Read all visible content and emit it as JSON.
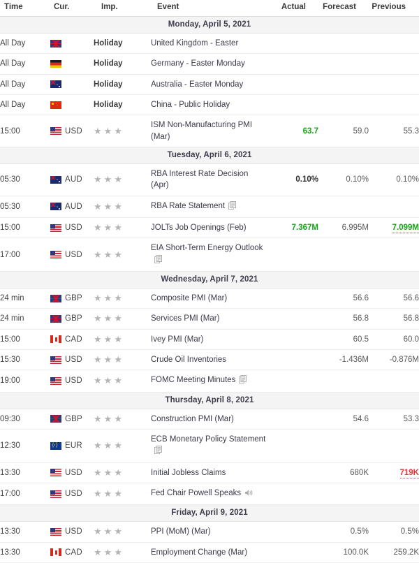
{
  "header": {
    "columns": [
      {
        "key": "time",
        "label": "Time"
      },
      {
        "key": "cur",
        "label": "Cur."
      },
      {
        "key": "imp",
        "label": "Imp."
      },
      {
        "key": "event",
        "label": "Event"
      },
      {
        "key": "actual",
        "label": "Actual"
      },
      {
        "key": "forecast",
        "label": "Forecast"
      },
      {
        "key": "previous",
        "label": "Previous"
      }
    ]
  },
  "colors": {
    "positive": "#13a713",
    "negative": "#e8333b",
    "date_band": "#f4f4f4",
    "star": "#b4b4b4",
    "text": "#3a3a4a"
  },
  "days": [
    {
      "date_label": "Monday, April 5, 2021",
      "rows": [
        {
          "time": "All Day",
          "currency": "",
          "flag": "gb-flag",
          "importance_type": "holiday",
          "importance_label": "Holiday",
          "stars": 0,
          "event": "United Kingdom - Easter",
          "event_icon": "",
          "actual": "",
          "actual_state": "none",
          "forecast": "",
          "previous": "",
          "previous_state": "none"
        },
        {
          "time": "All Day",
          "currency": "",
          "flag": "de-flag",
          "importance_type": "holiday",
          "importance_label": "Holiday",
          "stars": 0,
          "event": "Germany - Easter Monday",
          "event_icon": "",
          "actual": "",
          "actual_state": "none",
          "forecast": "",
          "previous": "",
          "previous_state": "none"
        },
        {
          "time": "All Day",
          "currency": "",
          "flag": "au-flag",
          "importance_type": "holiday",
          "importance_label": "Holiday",
          "stars": 0,
          "event": "Australia - Easter Monday",
          "event_icon": "",
          "actual": "",
          "actual_state": "none",
          "forecast": "",
          "previous": "",
          "previous_state": "none"
        },
        {
          "time": "All Day",
          "currency": "",
          "flag": "cn-flag",
          "importance_type": "holiday",
          "importance_label": "Holiday",
          "stars": 0,
          "event": "China - Public Holiday",
          "event_icon": "",
          "actual": "",
          "actual_state": "none",
          "forecast": "",
          "previous": "",
          "previous_state": "none"
        },
        {
          "time": "15:00",
          "currency": "USD",
          "flag": "us-flag",
          "importance_type": "stars",
          "importance_label": "",
          "stars": 3,
          "event": "ISM Non-Manufacturing PMI (Mar)",
          "event_icon": "",
          "actual": "63.7",
          "actual_state": "up",
          "forecast": "59.0",
          "previous": "55.3",
          "previous_state": "none"
        }
      ]
    },
    {
      "date_label": "Tuesday, April 6, 2021",
      "rows": [
        {
          "time": "05:30",
          "currency": "AUD",
          "flag": "au-flag",
          "importance_type": "stars",
          "importance_label": "",
          "stars": 3,
          "event": "RBA Interest Rate Decision (Apr)",
          "event_icon": "",
          "actual": "0.10%",
          "actual_state": "bold",
          "forecast": "0.10%",
          "previous": "0.10%",
          "previous_state": "none"
        },
        {
          "time": "05:30",
          "currency": "AUD",
          "flag": "au-flag",
          "importance_type": "stars",
          "importance_label": "",
          "stars": 3,
          "event": "RBA Rate Statement",
          "event_icon": "document-icon",
          "actual": "",
          "actual_state": "none",
          "forecast": "",
          "previous": "",
          "previous_state": "none"
        },
        {
          "time": "15:00",
          "currency": "USD",
          "flag": "us-flag",
          "importance_type": "stars",
          "importance_label": "",
          "stars": 3,
          "event": "JOLTs Job Openings (Feb)",
          "event_icon": "",
          "actual": "7.367M",
          "actual_state": "up",
          "forecast": "6.995M",
          "previous": "7.099M",
          "previous_state": "up-underline"
        },
        {
          "time": "17:00",
          "currency": "USD",
          "flag": "us-flag",
          "importance_type": "stars",
          "importance_label": "",
          "stars": 3,
          "event": "EIA Short-Term Energy Outlook",
          "event_icon": "document-icon",
          "actual": "",
          "actual_state": "none",
          "forecast": "",
          "previous": "",
          "previous_state": "none"
        }
      ]
    },
    {
      "date_label": "Wednesday, April 7, 2021",
      "rows": [
        {
          "time": "24 min",
          "currency": "GBP",
          "flag": "gb-flag",
          "importance_type": "stars",
          "importance_label": "",
          "stars": 3,
          "event": "Composite PMI (Mar)",
          "event_icon": "",
          "actual": "",
          "actual_state": "none",
          "forecast": "56.6",
          "previous": "56.6",
          "previous_state": "none"
        },
        {
          "time": "24 min",
          "currency": "GBP",
          "flag": "gb-flag",
          "importance_type": "stars",
          "importance_label": "",
          "stars": 3,
          "event": "Services PMI (Mar)",
          "event_icon": "",
          "actual": "",
          "actual_state": "none",
          "forecast": "56.8",
          "previous": "56.8",
          "previous_state": "none"
        },
        {
          "time": "15:00",
          "currency": "CAD",
          "flag": "ca-flag",
          "importance_type": "stars",
          "importance_label": "",
          "stars": 3,
          "event": "Ivey PMI (Mar)",
          "event_icon": "",
          "actual": "",
          "actual_state": "none",
          "forecast": "60.5",
          "previous": "60.0",
          "previous_state": "none"
        },
        {
          "time": "15:30",
          "currency": "USD",
          "flag": "us-flag",
          "importance_type": "stars",
          "importance_label": "",
          "stars": 3,
          "event": "Crude Oil Inventories",
          "event_icon": "",
          "actual": "",
          "actual_state": "none",
          "forecast": "-1.436M",
          "previous": "-0.876M",
          "previous_state": "none"
        },
        {
          "time": "19:00",
          "currency": "USD",
          "flag": "us-flag",
          "importance_type": "stars",
          "importance_label": "",
          "stars": 3,
          "event": "FOMC Meeting Minutes",
          "event_icon": "document-icon",
          "actual": "",
          "actual_state": "none",
          "forecast": "",
          "previous": "",
          "previous_state": "none"
        }
      ]
    },
    {
      "date_label": "Thursday, April 8, 2021",
      "rows": [
        {
          "time": "09:30",
          "currency": "GBP",
          "flag": "gb-flag",
          "importance_type": "stars",
          "importance_label": "",
          "stars": 3,
          "event": "Construction PMI (Mar)",
          "event_icon": "",
          "actual": "",
          "actual_state": "none",
          "forecast": "54.6",
          "previous": "53.3",
          "previous_state": "none"
        },
        {
          "time": "12:30",
          "currency": "EUR",
          "flag": "eu-flag",
          "importance_type": "stars",
          "importance_label": "",
          "stars": 3,
          "event": "ECB Monetary Policy Statement",
          "event_icon": "document-icon",
          "actual": "",
          "actual_state": "none",
          "forecast": "",
          "previous": "",
          "previous_state": "none"
        },
        {
          "time": "13:30",
          "currency": "USD",
          "flag": "us-flag",
          "importance_type": "stars",
          "importance_label": "",
          "stars": 3,
          "event": "Initial Jobless Claims",
          "event_icon": "",
          "actual": "",
          "actual_state": "none",
          "forecast": "680K",
          "previous": "719K",
          "previous_state": "down-underline"
        },
        {
          "time": "17:00",
          "currency": "USD",
          "flag": "us-flag",
          "importance_type": "stars",
          "importance_label": "",
          "stars": 3,
          "event": "Fed Chair Powell Speaks",
          "event_icon": "speaker-icon",
          "actual": "",
          "actual_state": "none",
          "forecast": "",
          "previous": "",
          "previous_state": "none"
        }
      ]
    },
    {
      "date_label": "Friday, April 9, 2021",
      "rows": [
        {
          "time": "13:30",
          "currency": "USD",
          "flag": "us-flag",
          "importance_type": "stars",
          "importance_label": "",
          "stars": 3,
          "event": "PPI (MoM) (Mar)",
          "event_icon": "",
          "actual": "",
          "actual_state": "none",
          "forecast": "0.5%",
          "previous": "0.5%",
          "previous_state": "none"
        },
        {
          "time": "13:30",
          "currency": "CAD",
          "flag": "ca-flag",
          "importance_type": "stars",
          "importance_label": "",
          "stars": 3,
          "event": "Employment Change (Mar)",
          "event_icon": "",
          "actual": "",
          "actual_state": "none",
          "forecast": "100.0K",
          "previous": "259.2K",
          "previous_state": "none"
        }
      ]
    }
  ]
}
